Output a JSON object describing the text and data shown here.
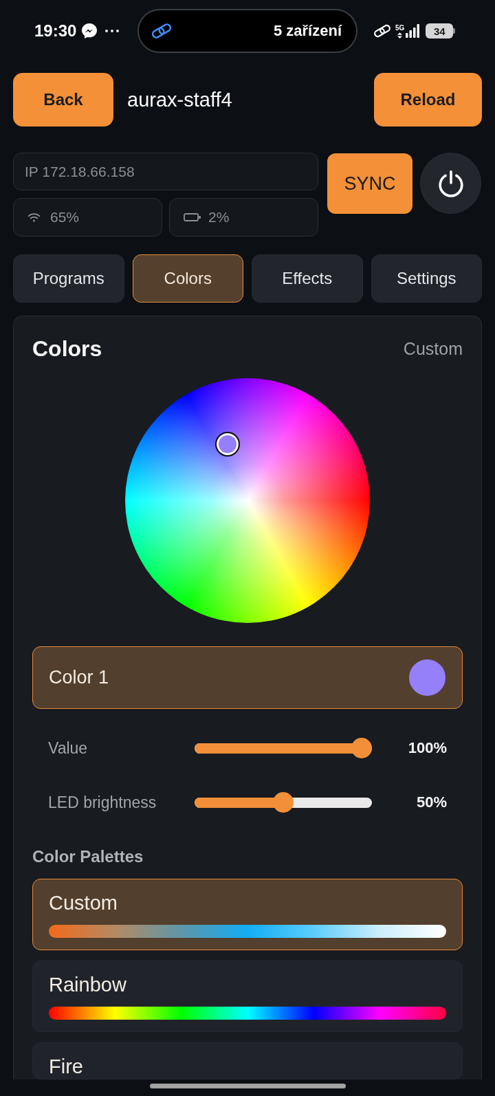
{
  "status_bar": {
    "time": "19:30",
    "devices_pill": "5 zařízení",
    "network_type": "5G",
    "battery": "34"
  },
  "header": {
    "back_button": "Back",
    "title": "aurax-staff4",
    "reload_button": "Reload"
  },
  "device": {
    "ip": "IP 172.18.66.158",
    "wifi": "65%",
    "battery": "2%",
    "sync_button": "SYNC"
  },
  "tabs": [
    {
      "label": "Programs",
      "selected": false
    },
    {
      "label": "Colors",
      "selected": true
    },
    {
      "label": "Effects",
      "selected": false
    },
    {
      "label": "Settings",
      "selected": false
    }
  ],
  "colors_panel": {
    "title": "Colors",
    "active_palette": "Custom",
    "color_slots": [
      {
        "label": "Color 1",
        "selected": true,
        "color": "#9580fa"
      }
    ],
    "sliders": [
      {
        "label": "Value",
        "level": 1,
        "reading": "100%"
      },
      {
        "label": "LED brightness",
        "level": 0.5,
        "reading": "50%"
      }
    ],
    "palettes_title": "Color Palettes",
    "palettes": [
      {
        "name": "Custom",
        "selected": true,
        "kind": "custom"
      },
      {
        "name": "Rainbow",
        "selected": false,
        "kind": "rainbow"
      },
      {
        "name": "Fire",
        "selected": false,
        "kind": "fire"
      }
    ]
  }
}
